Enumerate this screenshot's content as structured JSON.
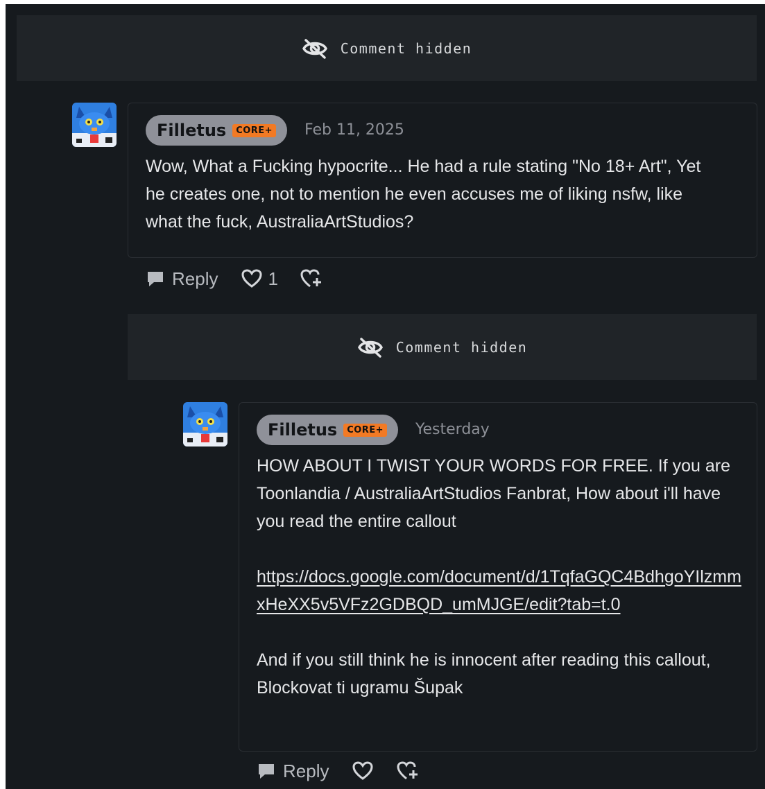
{
  "hidden_label": "Comment hidden",
  "comments": [
    {
      "username": "Filletus",
      "badge": "CORE+",
      "date": "Feb 11, 2025",
      "body": "Wow, What a Fucking hypocrite... He had a rule stating \"No 18+ Art\", Yet he creates one, not to mention he even accuses me of liking nsfw, like what the fuck, AustraliaArtStudios?",
      "reply_label": "Reply",
      "like_count": "1"
    },
    {
      "username": "Filletus",
      "badge": "CORE+",
      "date": "Yesterday",
      "body_para1": "HOW ABOUT I TWIST YOUR WORDS FOR FREE. If you are Toonlandia / AustraliaArtStudios Fanbrat, How about i'll have you read the entire callout",
      "link": "https://docs.google.com/document/d/1TqfaGQC4BdhgoYIlzmmxHeXX5v5VFz2GDBQD_umMJGE/edit?tab=t.0",
      "body_para2": "And if you still think he is innocent after reading this callout, Blockovat ti ugramu Šupak",
      "reply_label": "Reply"
    }
  ],
  "icons": {
    "hidden": "eye-slash-icon",
    "reply": "speech-bubble-icon",
    "like": "heart-icon",
    "award": "heart-gift-icon"
  },
  "colors": {
    "badge": "#f27a24",
    "background": "#161a1e",
    "pill": "#8f9199"
  }
}
